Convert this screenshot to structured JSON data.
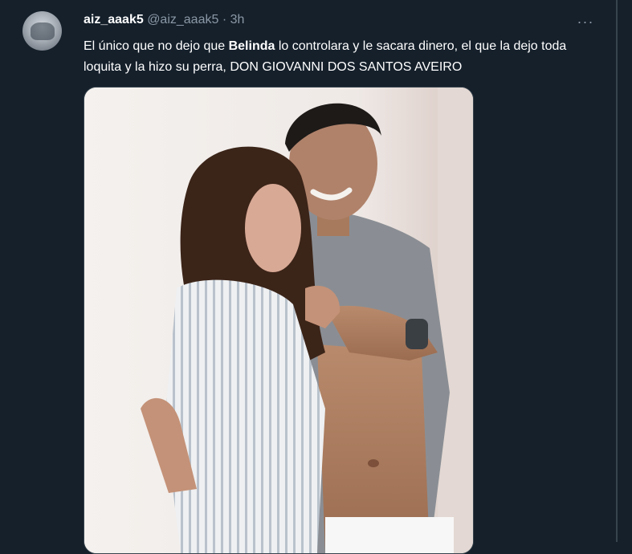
{
  "tweet": {
    "display_name": "aiz_aaak5",
    "handle": "@aiz_aaak5",
    "separator": "·",
    "time": "3h",
    "more_label": "···",
    "text_part1": "El único que no dejo que ",
    "text_bold": "Belinda",
    "text_part2": " lo controlara y le sacara dinero, el que la dejo toda loquita y la hizo su perra, DON GIOVANNI DOS SANTOS AVEIRO"
  },
  "icons": {
    "more": "more-horizontal-icon",
    "avatar": "user-avatar"
  },
  "colors": {
    "background": "#15202b",
    "primary_text": "#ffffff",
    "secondary_text": "#8b98a5",
    "border": "#38444d"
  }
}
